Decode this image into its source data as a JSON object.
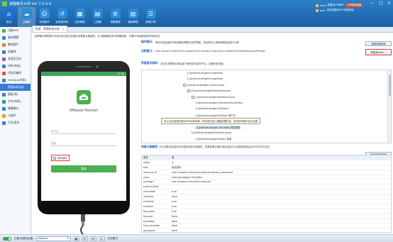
{
  "window": {
    "title": "按键精灵大师 Ver 7.5.0.0",
    "controls": [
      "—",
      "□",
      "×"
    ]
  },
  "toolbar": {
    "items": [
      {
        "label": "首页",
        "icon": "home-icon",
        "color": "#1e6fd6"
      },
      {
        "label": "云编译",
        "icon": "cloud-icon",
        "color": "#2a8bd6",
        "active": true
      },
      {
        "label": "在线制作",
        "icon": "robot-icon",
        "color": "#2f8fd8"
      },
      {
        "label": "还原源代码",
        "icon": "restore-icon",
        "color": "#2a8bd6"
      },
      {
        "label": "应用增强",
        "icon": "apps-icon",
        "color": "#2a8bd6"
      },
      {
        "label": "工具箱",
        "icon": "toolbox-icon",
        "color": "#2a8bd6"
      },
      {
        "label": "设备管理",
        "icon": "gear-icon",
        "color": "#2a8bd6"
      },
      {
        "label": "使用教程",
        "icon": "book-icon",
        "color": "#2a8bd6"
      },
      {
        "label": "家源订单",
        "icon": "order-icon",
        "color": "#2a8bd6"
      }
    ]
  },
  "vip": {
    "line1_prefix": "mmt",
    "line1_text": "您暂未VIP用户",
    "line1_tag": "VIP尊享通道",
    "line2_prefix": "gold",
    "line2_text": "您目前暂无VIP充值项目"
  },
  "sidebar": {
    "items": [
      {
        "label": "功能APK",
        "color": "#4caf50"
      },
      {
        "label": "某助提醒",
        "color": "#3a7bd5"
      },
      {
        "label": "解除图片",
        "color": "#e67e22"
      },
      {
        "label": "反编译",
        "color": "#3a7bd5"
      },
      {
        "label": "多面反汉化",
        "color": "#9b59b6"
      },
      {
        "label": "代码(布局)",
        "color": "#3a7bd5"
      },
      {
        "label": "代码反编译",
        "color": "#e74c3c"
      },
      {
        "label": "Xml(Java代码)",
        "color": "#3a7bd5"
      },
      {
        "label": "界面布局分析",
        "color": "#3a7bd5",
        "active": true
      },
      {
        "label": "搜索(类)",
        "color": "#3a7bd5"
      },
      {
        "label": "字节(布局)",
        "color": "#16a085"
      },
      {
        "label": "隐藏模式",
        "color": "#3a7bd5"
      },
      {
        "label": "小插件",
        "color": "#f39c12"
      },
      {
        "label": "打包/签名",
        "color": "#3a7bd5"
      }
    ]
  },
  "tab": {
    "label": "布局 · 界面布局分析",
    "close": "×"
  },
  "info_line": "此界面可帮助用户分析手机当前正在展示的界面元素结构，可以精确到控件ID的路径等，方便APK反编译后的代码定位",
  "phone": {
    "statusbar_time": "17:28",
    "app_name": "VMware Horizon",
    "field1_placeholder": "用户名",
    "field2_placeholder": "密码",
    "checkbox_label": "保存密码",
    "login_label": "登录"
  },
  "panel": {
    "row1_label": "操作提示:",
    "row1_text": "请将已经连接的手机调整到需要分析的界面，然后单击上面的刷新按钮进行分析",
    "refresh_button": "获取界面布局",
    "row2_label": "当前窗口:",
    "row2_text": "com.vmware.view.client.android/com.vmware.view.client.android.WindowsPasswordPrompt",
    "copy_button": "获取到main...",
    "row3_label": "界面层次结构:",
    "row3_text": "选中右侧界面元素或者下面的层次结构节点，查看布局详细",
    "tooltip": "可以点击某项目指向APK当前布局，然后双击进入搜索结果栏目，支持在布局中定位元素",
    "tree": [
      {
        "label": "[1]android.widget.ImageView",
        "depth": 4
      },
      {
        "label": "[1]android.widget.ImageView",
        "depth": 4
      },
      {
        "label": "[1]android.widget.LinearLayout",
        "depth": 3,
        "toggle": "-"
      },
      {
        "label": "[1]android.widget.RelativeLayout",
        "depth": 4,
        "toggle": "-"
      },
      {
        "label": "[1]android.widget.RelativeLayout",
        "depth": 5,
        "toggle": "-"
      },
      {
        "label": "[1]android.widget.HorizontalScrollView",
        "depth": 6
      },
      {
        "label": "[1]android.widget.TextView",
        "depth": 6
      },
      {
        "label": "[1]android.widget.EditText 用户名",
        "depth": 6
      },
      {
        "label": "[1]android.widget.EditText 密码",
        "depth": 6
      },
      {
        "label": "[1]android.widget.CheckBox 保存密码",
        "depth": 6,
        "selected": true
      },
      {
        "label": "[1]android.widget.RelativeLayout",
        "depth": 5
      },
      {
        "label": "[1]android.widget.Button 登录",
        "depth": 6
      }
    ],
    "prop_label": "布局元素属性:",
    "prop_text": "可以查看当前选中的元素的相关布局属性，如需查看元素的地址信息可以将属性复制后在APK文件中定位",
    "prop_button": "查找布局和代码",
    "prop_head": [
      "属性",
      "值"
    ],
    "props": [
      [
        "index",
        "4"
      ],
      [
        "text",
        "保存密码"
      ],
      [
        "resource-id",
        "com.vmware.view.client.android:id/save_password"
      ],
      [
        "class",
        "android.widget.CheckBox"
      ],
      [
        "package",
        "com.vmware.view.client.android"
      ],
      [
        "content-desc",
        ""
      ],
      [
        "checkable",
        "true"
      ],
      [
        "checked",
        "false"
      ],
      [
        "clickable",
        "true"
      ],
      [
        "enabled",
        "true"
      ],
      [
        "focusable",
        "true"
      ],
      [
        "focused",
        "false"
      ],
      [
        "scrollable",
        "false"
      ],
      [
        "long-clickable",
        "false"
      ],
      [
        "password",
        "false"
      ],
      [
        "selected",
        "false"
      ],
      [
        "bounds",
        "[88,1295][308,1383]"
      ]
    ]
  },
  "bottom": {
    "switch_label": "功能/查看的设备:",
    "device": "Xiaomi",
    "options_label": "手机模式"
  }
}
